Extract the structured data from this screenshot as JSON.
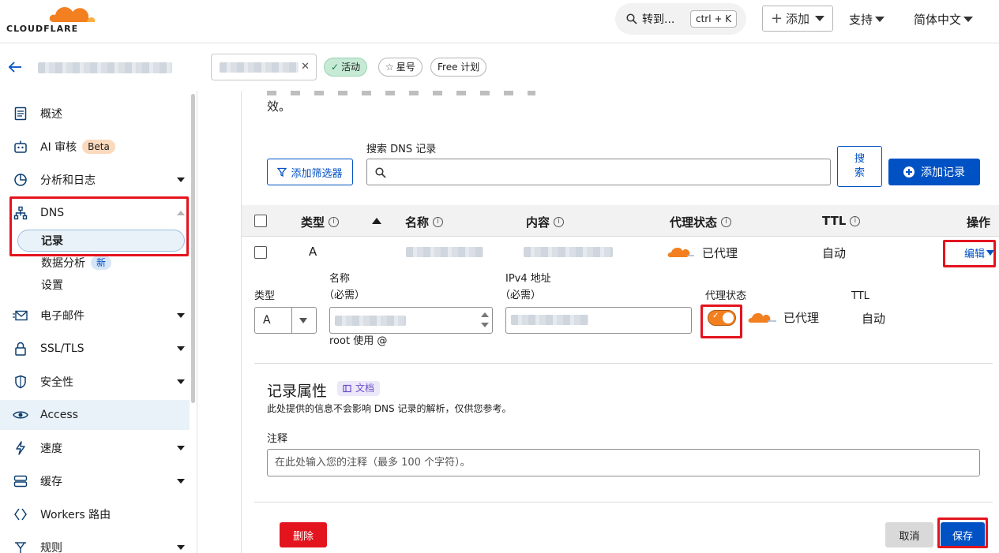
{
  "header": {
    "logo_text": "CLOUDFLARE",
    "search_label": "转到...",
    "search_shortcut": "ctrl + K",
    "add_label": "添加",
    "support_label": "支持",
    "language_label": "简体中文"
  },
  "zonebar": {
    "status_badge": "活动",
    "star_label": "星号",
    "plan_badge": "Free 计划"
  },
  "sidebar": {
    "items": [
      {
        "label": "概述",
        "icon": "document-icon"
      },
      {
        "label": "AI 审核",
        "icon": "robot-icon",
        "badge": "Beta"
      },
      {
        "label": "分析和日志",
        "icon": "pie-chart-icon"
      },
      {
        "label": "DNS",
        "icon": "network-icon"
      },
      {
        "label": "电子邮件",
        "icon": "email-icon"
      },
      {
        "label": "SSL/TLS",
        "icon": "lock-icon"
      },
      {
        "label": "安全性",
        "icon": "shield-icon"
      },
      {
        "label": "Access",
        "icon": "access-icon"
      },
      {
        "label": "速度",
        "icon": "lightning-icon"
      },
      {
        "label": "缓存",
        "icon": "server-icon"
      },
      {
        "label": "Workers 路由",
        "icon": "workers-icon"
      },
      {
        "label": "规则",
        "icon": "rules-icon"
      }
    ],
    "dns_sub": [
      {
        "label": "记录"
      },
      {
        "label": "数据分析",
        "badge": "新"
      },
      {
        "label": "设置"
      }
    ]
  },
  "main": {
    "intro_tail": "效。",
    "filter_button": "添加筛选器",
    "search_label": "搜索 DNS 记录",
    "search_button": "搜索",
    "add_record_button": "添加记录",
    "table": {
      "columns": [
        "类型",
        "名称",
        "内容",
        "代理状态",
        "TTL",
        "操作"
      ],
      "row": {
        "type": "A",
        "proxy_status": "已代理",
        "ttl": "自动",
        "action": "编辑"
      }
    },
    "edit_form": {
      "type_label": "类型",
      "type_value": "A",
      "name_label": "名称",
      "name_required": "（必需）",
      "name_hint": "root 使用 @",
      "ipv4_label": "IPv4 地址",
      "ipv4_required": "（必需）",
      "proxy_label": "代理状态",
      "proxy_value": "已代理",
      "proxy_on": true,
      "ttl_label": "TTL",
      "ttl_value": "自动"
    },
    "record_attributes": {
      "title": "记录属性",
      "doc_badge": "文档",
      "description": "此处提供的信息不会影响 DNS 记录的解析，仅供您参考。",
      "comment_label": "注释",
      "comment_placeholder": "在此处输入您的注释（最多 100 个字符）。"
    },
    "footer": {
      "delete_button": "删除",
      "cancel_button": "取消",
      "save_button": "保存"
    }
  },
  "colors": {
    "brand_orange": "#f38020",
    "primary_blue": "#0051c3",
    "danger_red": "#e3141e",
    "highlight_red": "#e3141e"
  }
}
